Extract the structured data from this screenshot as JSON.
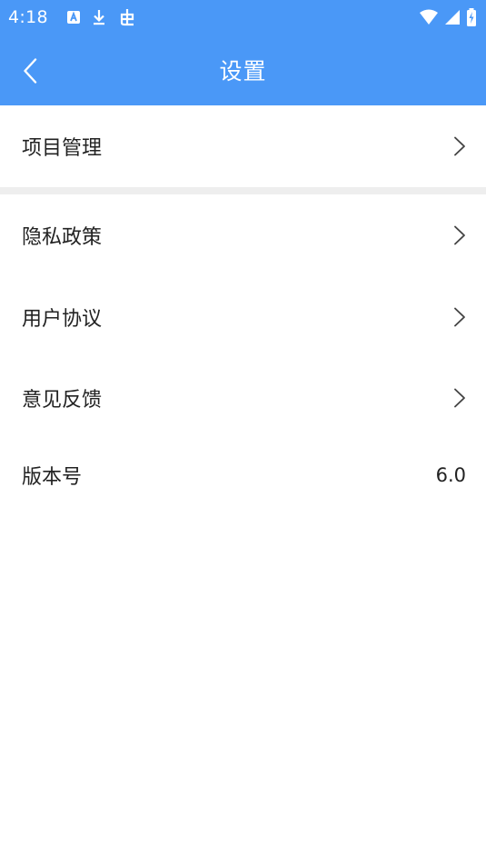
{
  "status_bar": {
    "time": "4:18",
    "left_icons": [
      "text-notification-icon",
      "download-icon",
      "debug-bug-icon"
    ],
    "right_icons": [
      "wifi-icon",
      "signal-icon",
      "battery-charging-icon"
    ]
  },
  "header": {
    "title": "设置",
    "back_icon": "back-arrow-icon",
    "background_color": "#4a98f7"
  },
  "settings": {
    "project": {
      "label": "项目管理",
      "icon": "chevron-right-icon"
    },
    "privacy": {
      "label": "隐私政策",
      "icon": "chevron-right-icon"
    },
    "agreement": {
      "label": "用户协议",
      "icon": "chevron-right-icon"
    },
    "feedback": {
      "label": "意见反馈",
      "icon": "chevron-right-icon"
    },
    "version": {
      "label": "版本号",
      "value": "6.0"
    }
  }
}
